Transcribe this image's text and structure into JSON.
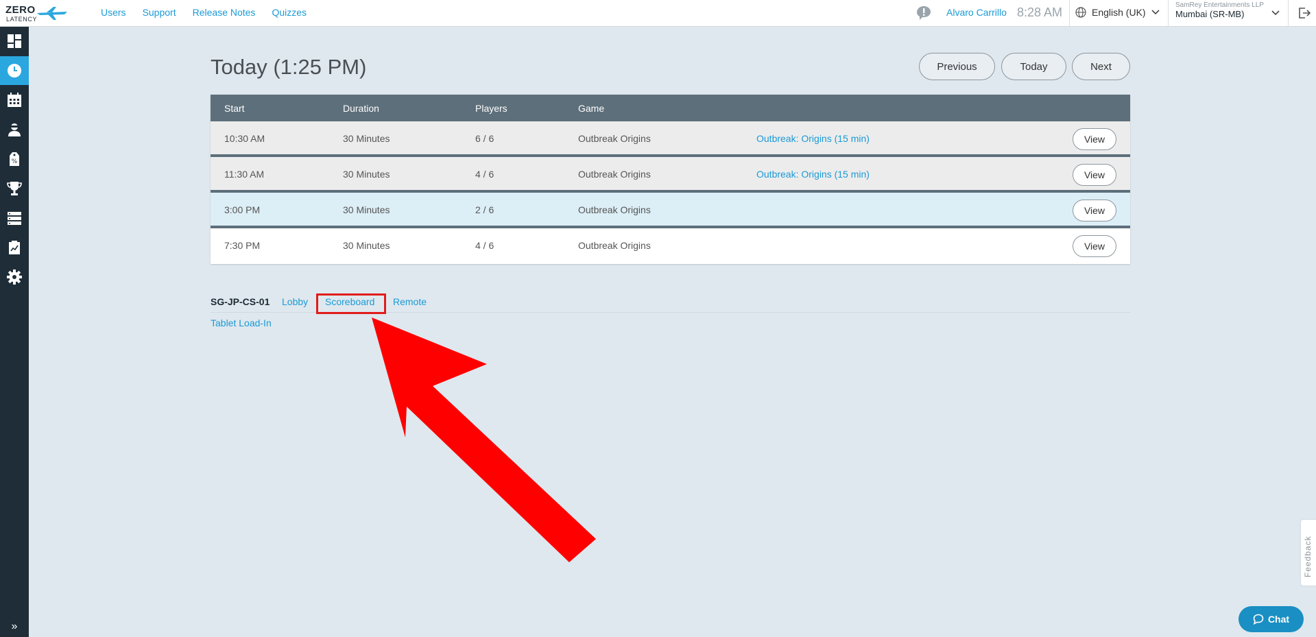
{
  "logo": {
    "line1": "ZERO",
    "line2": "LATENCY"
  },
  "topnav": {
    "items": [
      "Users",
      "Support",
      "Release Notes",
      "Quizzes"
    ]
  },
  "header": {
    "user": "Alvaro Carrillo",
    "time": "8:28 AM",
    "language": "English (UK)",
    "org_name": "SamRey Entertainments LLP",
    "org_location": "Mumbai (SR-MB)"
  },
  "sidebar": {
    "items": [
      "dashboard-icon",
      "clock-icon",
      "calendar-icon",
      "player-icon",
      "discount-icon",
      "trophy-icon",
      "server-icon",
      "report-icon",
      "settings-icon"
    ],
    "active_index": 1,
    "expand_label": "»"
  },
  "main": {
    "title": "Today (1:25 PM)",
    "buttons": {
      "previous": "Previous",
      "today": "Today",
      "next": "Next"
    }
  },
  "table": {
    "headers": {
      "start": "Start",
      "duration": "Duration",
      "players": "Players",
      "game": "Game"
    },
    "rows": [
      {
        "start": "10:30 AM",
        "duration": "30 Minutes",
        "players": "6 / 6",
        "game": "Outbreak Origins",
        "session": "Outbreak: Origins (15 min)",
        "action": "View"
      },
      {
        "start": "11:30 AM",
        "duration": "30 Minutes",
        "players": "4 / 6",
        "game": "Outbreak Origins",
        "session": "Outbreak: Origins (15 min)",
        "action": "View"
      },
      {
        "start": "3:00 PM",
        "duration": "30 Minutes",
        "players": "2 / 6",
        "game": "Outbreak Origins",
        "session": "",
        "action": "View"
      },
      {
        "start": "7:30 PM",
        "duration": "30 Minutes",
        "players": "4 / 6",
        "game": "Outbreak Origins",
        "session": "",
        "action": "View"
      }
    ]
  },
  "device": {
    "name": "SG-JP-CS-01",
    "links": {
      "lobby": "Lobby",
      "scoreboard": "Scoreboard",
      "remote": "Remote"
    },
    "tablet": "Tablet Load-In"
  },
  "feedback": "Feedback",
  "chat": "Chat",
  "colors": {
    "accent": "#1a9ad6",
    "sidebar": "#1e2d37",
    "active": "#2aa7df",
    "table_header": "#5d6f7a",
    "annotation": "#ff0000"
  }
}
